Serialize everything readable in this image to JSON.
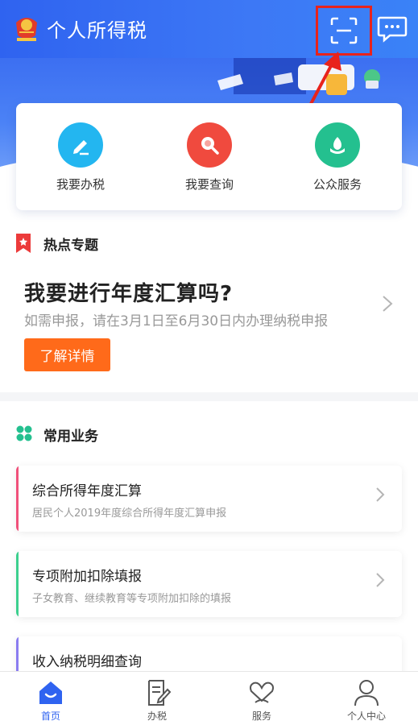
{
  "header": {
    "title": "个人所得税",
    "logo_icon": "tax-emblem-icon",
    "scan_icon": "scan-icon",
    "message_icon": "message-icon",
    "accent": "#2f63f0"
  },
  "banner": {
    "slides_total": 3,
    "active_slide": 1
  },
  "quick_services": [
    {
      "label": "我要办税",
      "icon": "pencil-icon",
      "color": "#23b6f0"
    },
    {
      "label": "我要查询",
      "icon": "magnifier-icon",
      "color": "#f04a3e"
    },
    {
      "label": "公众服务",
      "icon": "flower-icon",
      "color": "#24c08f"
    }
  ],
  "hot_topic": {
    "section_title": "热点专题",
    "heading": "我要进行年度汇算吗?",
    "subtitle": "如需申报，请在3月1日至6月30日内办理纳税申报",
    "button_label": "了解详情",
    "button_color": "#ff6a1a"
  },
  "common_business": {
    "section_title": "常用业务",
    "items": [
      {
        "title": "综合所得年度汇算",
        "subtitle": "居民个人2019年度综合所得年度汇算申报",
        "accent": "#f0507a"
      },
      {
        "title": "专项附加扣除填报",
        "subtitle": "子女教育、继续教育等专项附加扣除的填报",
        "accent": "#3ccf8e"
      },
      {
        "title": "收入纳税明细查询",
        "subtitle": "",
        "accent": "#8a7cf0"
      }
    ]
  },
  "bottom_nav": [
    {
      "label": "首页",
      "icon": "home-icon",
      "active": true
    },
    {
      "label": "办税",
      "icon": "form-edit-icon",
      "active": false
    },
    {
      "label": "服务",
      "icon": "heart-hands-icon",
      "active": false
    },
    {
      "label": "个人中心",
      "icon": "person-icon",
      "active": false
    }
  ]
}
